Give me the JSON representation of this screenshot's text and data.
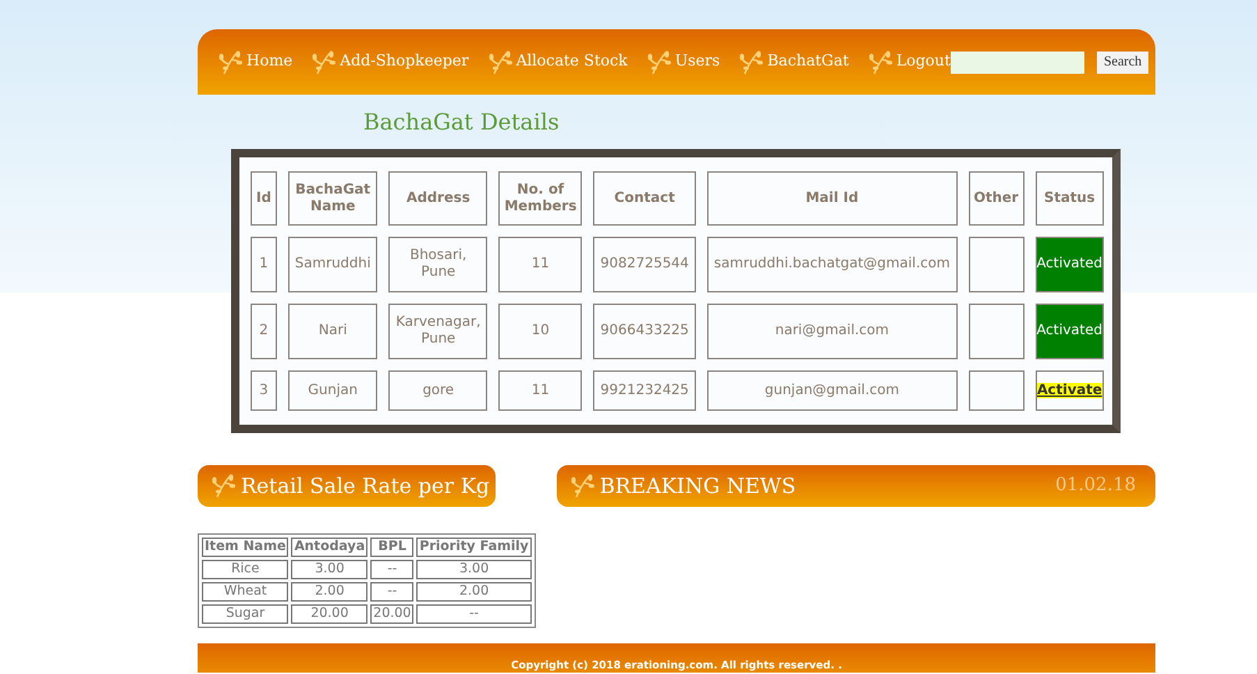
{
  "nav": {
    "items": [
      {
        "label": "Home"
      },
      {
        "label": "Add-Shopkeeper"
      },
      {
        "label": "Allocate Stock"
      },
      {
        "label": "Users"
      },
      {
        "label": "BachatGat"
      },
      {
        "label": "Logout"
      }
    ],
    "search_button": "Search"
  },
  "page_title": "BachaGat Details",
  "table": {
    "columns": [
      "Id",
      "BachaGat Name",
      "Address",
      "No. of Members",
      "Contact",
      "Mail Id",
      "Other",
      "Status"
    ],
    "rows": [
      {
        "cells": [
          "1",
          "Samruddhi",
          "Bhosari, Pune",
          "11",
          "9082725544",
          "samruddhi.bachatgat@gmail.com",
          ""
        ],
        "status": {
          "text": "Activated",
          "activated": true
        }
      },
      {
        "cells": [
          "2",
          "Nari",
          "Karvenagar, Pune",
          "10",
          "9066433225",
          "nari@gmail.com",
          ""
        ],
        "status": {
          "text": "Activated",
          "activated": true
        }
      },
      {
        "cells": [
          "3",
          "Gunjan",
          "gore",
          "11",
          "9921232425",
          "gunjan@gmail.com",
          ""
        ],
        "status": {
          "text": "Activate",
          "activated": false
        }
      }
    ]
  },
  "rate_panel": {
    "title": "Retail Sale Rate per Kg",
    "columns": [
      "Item Name",
      "Antodaya",
      "BPL",
      "Priority Family"
    ],
    "rows": [
      [
        "Rice",
        "3.00",
        "--",
        "3.00"
      ],
      [
        "Wheat",
        "2.00",
        "--",
        "2.00"
      ],
      [
        "Sugar",
        "20.00",
        "20.00",
        "--"
      ]
    ]
  },
  "news_panel": {
    "title": "BREAKING NEWS",
    "date": "01.02.18"
  },
  "footer": {
    "text": "Copyright (c) 2018 erationing.com. All rights reserved. ."
  }
}
